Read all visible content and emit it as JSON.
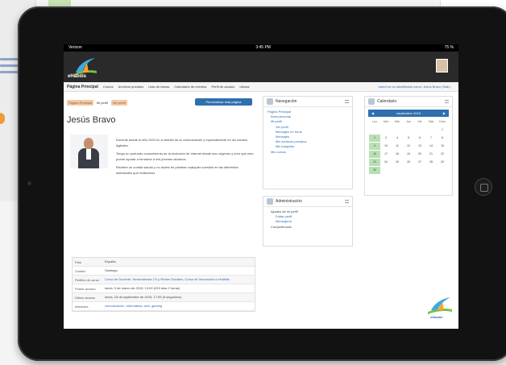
{
  "status_bar": {
    "carrier": "Verizon",
    "time": "3:45 PM",
    "battery": "75 %"
  },
  "site": {
    "name": "eHabilis"
  },
  "navbar": {
    "home": "Página Principal",
    "items": [
      "Cursos",
      "Archivos privados",
      "Lista de tareas",
      "Calendario de eventos",
      "Perfil de usuario",
      "Idioma"
    ],
    "user_text": "Usted se ha identificado como: Jesús Bravo (Salir)"
  },
  "breadcrumb": [
    "Página Principal",
    "Mi perfil",
    "Ver perfil"
  ],
  "customize_button": "Personalizar esta página",
  "profile": {
    "name": "Jesús Bravo",
    "bio": [
      "Docente desde el año 2002 en el ámbito de la comunicación y especialmente en los medios digitales.",
      "Tengo un profundo conocimiento de la evolución de Internet desde sus orígenes y creo que esto puede ayudar a formarse a mis jóvenes alumnos.",
      "Recibiré un cordial saludo y no dudes en plantear cualquier cuestión en las diferentes actividades que realizamos"
    ],
    "details": [
      {
        "key": "País",
        "value": "España",
        "link": false
      },
      {
        "key": "Ciudad",
        "value": "Santiago",
        "link": false
      },
      {
        "key": "Perfiles de curso",
        "value": "Curso de Docente, Herramientas 2.0 y Redes Sociales, Curso de Innovación a eHabilis",
        "link": true
      },
      {
        "key": "Primer acceso",
        "value": "lunes, 9 de marzo de 2015, 13:09  (203 días 2 horas)",
        "link": false
      },
      {
        "key": "Último acceso",
        "value": "lunes, 15 de septiembre de 2015, 17:09  (9 segundos)",
        "link": false
      },
      {
        "key": "Intereses",
        "value": "comunicación, informática, web, gaming",
        "link": true
      }
    ]
  },
  "navigation_block": {
    "title": "Navegación",
    "links": [
      {
        "label": "Página Principal",
        "level": 0
      },
      {
        "label": "Área personal",
        "level": 1
      },
      {
        "label": "Mi perfil",
        "level": 1
      },
      {
        "label": "Ver perfil",
        "level": 2
      },
      {
        "label": "Mensajes en foros",
        "level": 2
      },
      {
        "label": "Mensajes",
        "level": 2
      },
      {
        "label": "Mis archivos privados",
        "level": 2
      },
      {
        "label": "Mis insignias",
        "level": 2
      },
      {
        "label": "Mis cursos",
        "level": 1
      }
    ]
  },
  "admin_block": {
    "title": "Administración",
    "links": [
      {
        "label": "Ajustes de mi perfil",
        "level": 1,
        "plain": true
      },
      {
        "label": "Editar perfil",
        "level": 2,
        "plain": false
      },
      {
        "label": "Mensajería",
        "level": 2,
        "plain": false
      },
      {
        "label": "Competencias",
        "level": 1,
        "plain": true
      }
    ]
  },
  "calendar": {
    "title": "Calendario",
    "month": "septiembre 2015",
    "weekdays": [
      "Lun",
      "Mar",
      "Mié",
      "Jue",
      "Vie",
      "Sáb",
      "Dom"
    ],
    "days": [
      "",
      "",
      "",
      "",
      "",
      "",
      "1",
      "2",
      "3",
      "4",
      "5",
      "6",
      "7",
      "8",
      "9",
      "10",
      "11",
      "12",
      "13",
      "14",
      "15",
      "16",
      "17",
      "18",
      "19",
      "20",
      "21",
      "22",
      "23",
      "24",
      "25",
      "26",
      "27",
      "28",
      "29",
      "30"
    ]
  },
  "colors": {
    "primary": "#2f6fae",
    "link": "#2a6fb5",
    "calendar_weekend": "#b9dfb4"
  }
}
